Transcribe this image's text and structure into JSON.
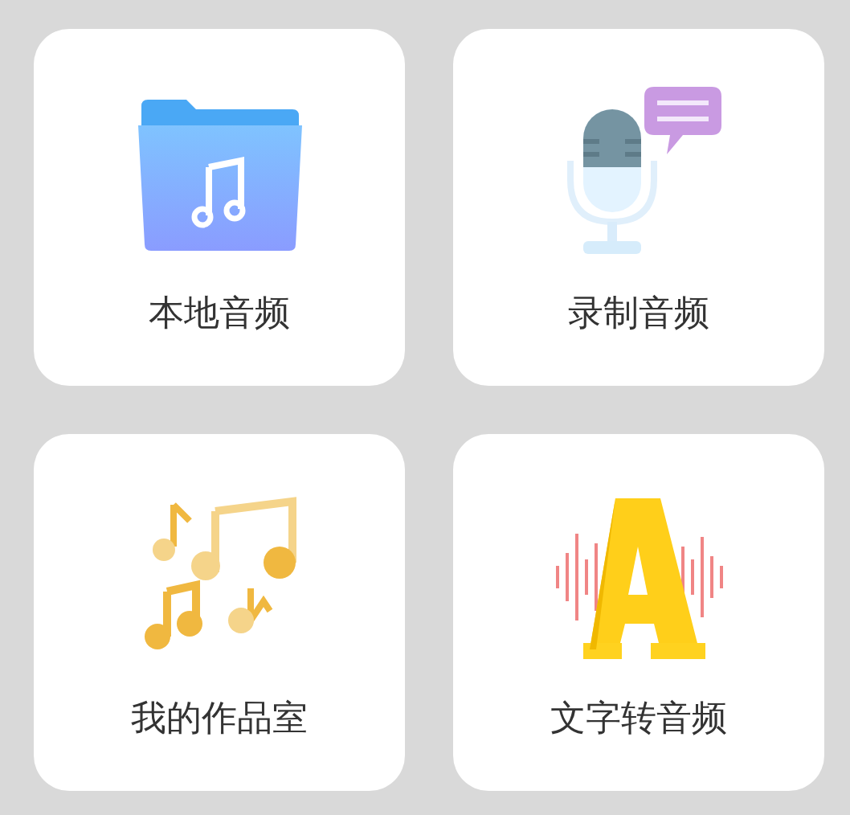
{
  "cards": [
    {
      "label": "本地音频",
      "kind": "folder"
    },
    {
      "label": "录制音频",
      "kind": "mic"
    },
    {
      "label": "我的作品室",
      "kind": "notes"
    },
    {
      "label": "文字转音频",
      "kind": "text"
    }
  ]
}
